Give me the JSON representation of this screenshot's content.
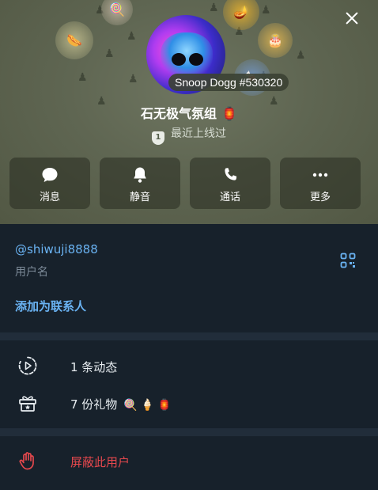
{
  "profile": {
    "name": "石无极气氛组",
    "name_emoji": "🏮",
    "status": "最近上线过",
    "shield_number": "1",
    "nft_badge": "Snoop Dogg #530320"
  },
  "header_gifts": [
    "🍭",
    "🌭",
    "🎂",
    "🪔",
    "🍬"
  ],
  "pattern_glyph": "♟",
  "actions": [
    {
      "label": "消息",
      "icon": "message-icon"
    },
    {
      "label": "静音",
      "icon": "bell-icon"
    },
    {
      "label": "通话",
      "icon": "phone-icon"
    },
    {
      "label": "更多",
      "icon": "more-icon"
    }
  ],
  "info": {
    "username": "@shiwuji8888",
    "username_label": "用户名",
    "add_contact": "添加为联系人"
  },
  "stories": {
    "text": "1 条动态",
    "icon": "stories-icon"
  },
  "gifts": {
    "text": "7 份礼物",
    "emojis": "🍭🍦🏮",
    "icon": "gift-icon"
  },
  "block": {
    "text": "屏蔽此用户",
    "icon": "hand-icon"
  },
  "colors": {
    "background": "#17212b",
    "divider": "#212d3a",
    "link": "#6ab3f3",
    "danger": "#e5484d",
    "header": "#5f6652"
  }
}
